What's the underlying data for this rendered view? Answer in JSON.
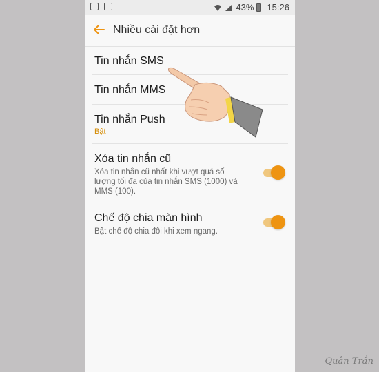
{
  "status_bar": {
    "battery": "43%",
    "time": "15:26"
  },
  "toolbar": {
    "title": "Nhiều cài đặt hơn"
  },
  "items": [
    {
      "title": "Tin nhắn SMS"
    },
    {
      "title": "Tin nhắn MMS"
    },
    {
      "title": "Tin nhắn Push",
      "subtitle": "Bật"
    },
    {
      "title": "Xóa tin nhắn cũ",
      "description": "Xóa tin nhắn cũ nhất khi vượt quá số lượng tối đa của tin nhắn SMS (1000) và MMS (100).",
      "toggle_on": true
    },
    {
      "title": "Chế độ chia màn hình",
      "description": "Bật chế độ chia đôi khi xem ngang.",
      "toggle_on": true
    }
  ],
  "watermark": "Quân Trần",
  "colors": {
    "accent": "#ee9412",
    "subtitle": "#d48a00",
    "background": "#c3c1c2"
  }
}
